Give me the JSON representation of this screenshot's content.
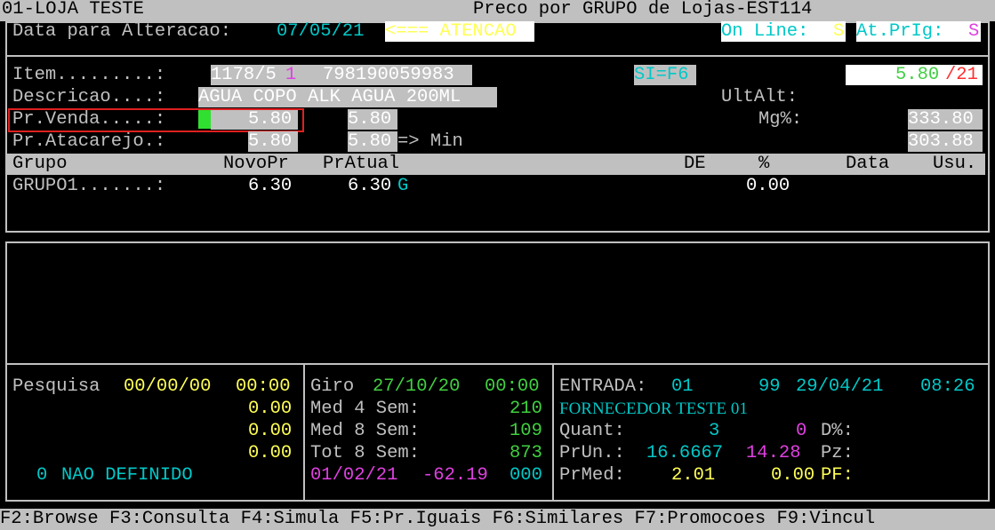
{
  "title_bar": {
    "store": "01-LOJA TESTE",
    "screen_title": "Preco por GRUPO de Lojas-EST114"
  },
  "header": {
    "date_label": "Data para Alteracao:",
    "date_value": "07/05/21",
    "warning": "<=== ATENCAO",
    "online_label": "On Line:",
    "online_value": "S",
    "atprg_label": "At.PrIg:",
    "atprg_value": "S"
  },
  "item": {
    "label": "Item.........:",
    "code": "1178/5",
    "code_suffix": "1",
    "barcode": "798190059983",
    "si_hint": "SI=F6",
    "price_box": "5.80",
    "price_box_suffix": "/21"
  },
  "descricao": {
    "label": "Descricao....:",
    "value": "AGUA COPO ALK AGUA 200ML",
    "ultalt_label": "UltAlt:"
  },
  "pr_venda": {
    "label": "Pr.Venda.....:",
    "new_value": "5.80",
    "current_value": "5.80",
    "mg_label": "Mg%:",
    "mg_value": "333.80"
  },
  "pr_atacarejo": {
    "label": "Pr.Atacarejo.:",
    "new_value": "5.80",
    "current_value": "5.80",
    "min_label": "=> Min",
    "mg_value": "303.88"
  },
  "grid": {
    "columns": [
      "Grupo",
      "NovoPr",
      "PrAtual",
      "DE",
      "%",
      "Data",
      "Usu."
    ],
    "rows": [
      {
        "grupo": "GRUPO1.......:",
        "novo_pr": "6.30",
        "pr_atual": "6.30",
        "flag": "G",
        "pct": "0.00"
      }
    ]
  },
  "pesquisa": {
    "label": "Pesquisa",
    "date": "00/00/00",
    "time": "00:00",
    "values": [
      "0.00",
      "0.00",
      "0.00"
    ],
    "status_count": "0",
    "status_text": "NAO DEFINIDO"
  },
  "giro": {
    "label": "Giro",
    "date": "27/10/20",
    "time": "00:00",
    "med4_label": "Med 4 Sem:",
    "med4_value": "210",
    "med8_label": "Med 8 Sem:",
    "med8_value": "109",
    "tot8_label": "Tot 8 Sem:",
    "tot8_value": "873",
    "last_date": "01/02/21",
    "last_value": "-62.19",
    "last_code": "000"
  },
  "entrada": {
    "label": "ENTRADA:",
    "code": "01",
    "num": "99",
    "date": "29/04/21",
    "time": "08:26",
    "supplier": "FORNECEDOR TESTE 01",
    "quant_label": "Quant:",
    "quant_value": "3",
    "quant_zero": "0",
    "dpct_label": "D%:",
    "prun_label": "PrUn.:",
    "prun_value": "16.6667",
    "prun_pct": "14.28",
    "pz_label": "Pz:",
    "prmed_label": "PrMed:",
    "prmed_value": "2.01",
    "prmed_value2": "0.00",
    "pf_label": "PF:"
  },
  "footer": {
    "keys": "F2:Browse F3:Consulta F4:Simula F5:Pr.Iguais F6:Similares F7:Promocoes F9:Vincul"
  },
  "colors": {
    "terminal_bg": "#000000",
    "bar_gray": "#c0c0c0",
    "cyan": "#00c8c8",
    "yellow": "#ffff55",
    "green": "#40d040",
    "magenta": "#e040e0",
    "highlight_red": "#e02020"
  }
}
